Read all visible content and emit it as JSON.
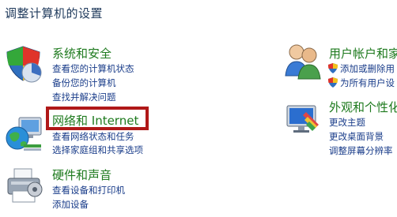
{
  "page": {
    "title": "调整计算机的设置"
  },
  "left": {
    "system_security": {
      "title": "系统和安全",
      "links": [
        "查看您的计算机状态",
        "备份您的计算机",
        "查找并解决问题"
      ]
    },
    "network": {
      "title": "网络和 Internet",
      "links": [
        "查看网络状态和任务",
        "选择家庭组和共享选项"
      ]
    },
    "hardware": {
      "title": "硬件和声音",
      "links": [
        "查看设备和打印机",
        "添加设备"
      ]
    }
  },
  "right": {
    "user_accounts": {
      "title": "用户帐户和家",
      "links": [
        "添加或删除用",
        "为所有用户设"
      ]
    },
    "appearance": {
      "title": "外观和个性化",
      "links": [
        "更改主题",
        "更改桌面背景",
        "调整屏幕分辨率"
      ]
    }
  },
  "colors": {
    "category_title": "#1e7a1e",
    "link": "#1a3d8a",
    "highlight": "#b01818"
  }
}
